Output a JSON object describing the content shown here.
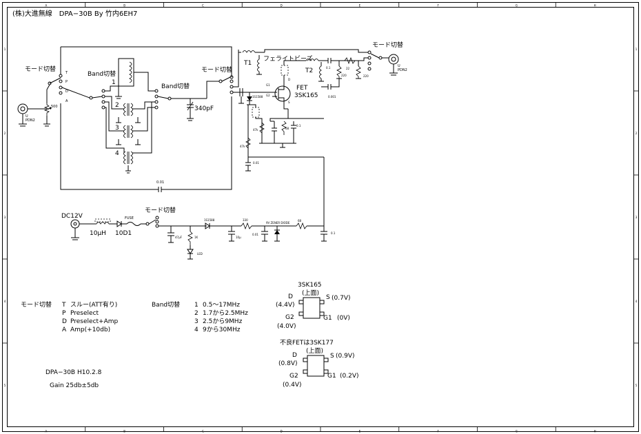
{
  "title": "(株)大進無線　DPA−30B  By  竹内6EH7",
  "grid_cols": [
    "A",
    "B",
    "C",
    "D",
    "E",
    "F",
    "G",
    "H"
  ],
  "grid_rows": [
    "1",
    "2",
    "3",
    "4",
    "5"
  ],
  "labels": {
    "mode_switch": "モード切替",
    "band_switch": "Band切替",
    "ferrite": "フェライトビーズ",
    "t1": "T1",
    "t2": "T2",
    "fet": "FET",
    "fet_part": "3SK165",
    "cap_340": "340pF",
    "dc": "DC12V",
    "l10": "10μH",
    "d10": "10D1",
    "fuse": "FUSE",
    "d1s1588": "1S1588",
    "r330": "330",
    "zener": "9V ZENER DIODE",
    "r68": "68",
    "c001": "0.01",
    "c01": "0.1",
    "c47": "47μF",
    "r1k": "1K",
    "led": "LED",
    "c10u": "10μ",
    "vr500": "500",
    "r47k": "47k",
    "r68b": "68",
    "pos_t": "T",
    "pos_p": "P",
    "pos_d": "D",
    "pos_a": "A",
    "band_1": "1",
    "band_2": "2",
    "band_3": "3",
    "band_4": "4",
    "conn_left": "PDN2",
    "conn_right": "PDN2",
    "conn_u": "U",
    "r220": "220",
    "r22": "22"
  },
  "legend_mode": {
    "heading": "モード切替",
    "items": [
      {
        "key": "T",
        "text": "スルー(ATT有り)"
      },
      {
        "key": "P",
        "text": "Preselect"
      },
      {
        "key": "D",
        "text": "Preselect+Amp"
      },
      {
        "key": "A",
        "text": "Amp(+10db)"
      }
    ]
  },
  "legend_band": {
    "heading": "Band切替",
    "items": [
      {
        "key": "1",
        "text": "0.5〜17MHz"
      },
      {
        "key": "2",
        "text": "1.7から2.5MHz"
      },
      {
        "key": "3",
        "text": "2.5から9MHz"
      },
      {
        "key": "4",
        "text": "9から30MHz"
      }
    ]
  },
  "pinout1": {
    "part": "3SK165",
    "top": "(上面)",
    "d": "D",
    "d_v": "(4.4V)",
    "s": "S",
    "s_v": "(0.7V)",
    "g2": "G2",
    "g2_v": "(4.0V)",
    "g1": "G1",
    "g1_v": "(0V)"
  },
  "pinout2": {
    "part": "不良FETは3SK177",
    "top": "(上面)",
    "d": "D",
    "d_v": "(0.8V)",
    "s": "S",
    "s_v": "(0.9V)",
    "g2": "G2",
    "g2_v": "(0.4V)",
    "g1": "G1",
    "g1_v": "(0.2V)"
  },
  "notes": {
    "model": "DPA−30B H10.2.8",
    "gain": "Gain  25db±5db"
  }
}
